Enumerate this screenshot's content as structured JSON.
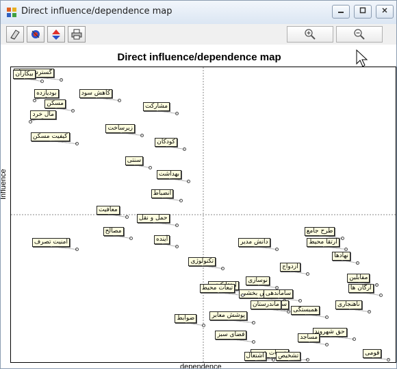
{
  "window": {
    "title": "Direct influence/dependence map",
    "controls": [
      {
        "name": "minimize-button",
        "icon": "minimize-icon"
      },
      {
        "name": "maximize-button",
        "icon": "maximize-icon"
      },
      {
        "name": "close-button",
        "icon": "close-icon"
      }
    ]
  },
  "toolbar": {
    "buttons": [
      {
        "name": "copy-button",
        "icon": "copy-icon"
      },
      {
        "name": "colors-button",
        "icon": "colors-icon"
      },
      {
        "name": "options-button",
        "icon": "options-icon"
      },
      {
        "name": "print-button",
        "icon": "print-icon"
      }
    ],
    "zoom_in": {
      "name": "zoom-in-button",
      "icon": "zoom-in-icon"
    },
    "zoom_out": {
      "name": "zoom-out-button",
      "icon": "zoom-out-icon"
    }
  },
  "chart_data": {
    "type": "scatter",
    "title": "Direct influence/dependence map",
    "xlabel": "dependence",
    "ylabel": "Influence",
    "quadrant_divider": "dashed",
    "points": [
      {
        "label": "گسترش شغل",
        "q": [
          0.12,
          0.02
        ]
      },
      {
        "label": "بیکاران",
        "q": [
          0.07,
          0.03
        ]
      },
      {
        "label": "بودیازده",
        "q": [
          0.05,
          0.1
        ]
      },
      {
        "label": "مسکن",
        "q": [
          0.15,
          0.14
        ]
      },
      {
        "label": "مال خرد",
        "q": [
          0.04,
          0.18
        ]
      },
      {
        "label": "کاهش سود",
        "q": [
          0.27,
          0.1
        ]
      },
      {
        "label": "مشارکت",
        "q": [
          0.42,
          0.15
        ]
      },
      {
        "label": "زیرساخت",
        "q": [
          0.33,
          0.23
        ]
      },
      {
        "label": "کیفیت مسکن",
        "q": [
          0.16,
          0.26
        ]
      },
      {
        "label": "کودکان",
        "q": [
          0.44,
          0.28
        ]
      },
      {
        "label": "سنتی",
        "q": [
          0.35,
          0.35
        ]
      },
      {
        "label": "بهداشت",
        "q": [
          0.45,
          0.4
        ]
      },
      {
        "label": "انضباط",
        "q": [
          0.43,
          0.47
        ]
      },
      {
        "label": "معافیت",
        "q": [
          0.29,
          0.53
        ]
      },
      {
        "label": "حمل و نقل",
        "q": [
          0.42,
          0.56
        ]
      },
      {
        "label": "امنیت تصرف",
        "q": [
          0.16,
          0.65
        ]
      },
      {
        "label": "مصالح",
        "q": [
          0.3,
          0.61
        ]
      },
      {
        "label": "آینده",
        "q": [
          0.42,
          0.64
        ]
      },
      {
        "label": "طرح جامع",
        "q": [
          0.85,
          0.61
        ]
      },
      {
        "label": "ارتقا محیط",
        "q": [
          0.86,
          0.65
        ]
      },
      {
        "label": "دانش مدیر",
        "q": [
          0.68,
          0.65
        ]
      },
      {
        "label": "تکنولوژی",
        "q": [
          0.54,
          0.72
        ]
      },
      {
        "label": "ازدواج",
        "q": [
          0.76,
          0.74
        ]
      },
      {
        "label": "نوسازی",
        "q": [
          0.68,
          0.79
        ]
      },
      {
        "label": "ارتقا کیفی",
        "q": [
          0.6,
          0.81
        ]
      },
      {
        "label": "نگرش بخشی",
        "q": [
          0.7,
          0.84
        ]
      },
      {
        "label": "ارگان ها",
        "q": [
          0.95,
          0.82
        ]
      },
      {
        "label": "سواد زنان",
        "q": [
          0.73,
          0.88
        ]
      },
      {
        "label": "ضوابط",
        "q": [
          0.49,
          0.93
        ]
      }
    ],
    "near_zero": [
      {
        "label": "تبعات محیط",
        "q": [
          0.59,
          0.82
        ]
      },
      {
        "label": "ساماندهی",
        "q": [
          0.74,
          0.84
        ]
      },
      {
        "label": "ماندرستان",
        "q": [
          0.71,
          0.88
        ]
      },
      {
        "label": "همبستگی",
        "q": [
          0.81,
          0.9
        ]
      },
      {
        "label": "نهادها",
        "q": [
          0.89,
          0.7
        ]
      },
      {
        "label": "مقابلین",
        "q": [
          0.94,
          0.78
        ]
      },
      {
        "label": "ناهنجاری",
        "q": [
          0.92,
          0.88
        ]
      },
      {
        "label": "پوشش معابر",
        "q": [
          0.62,
          0.92
        ]
      },
      {
        "label": "فضای سبز",
        "q": [
          0.62,
          0.99
        ]
      },
      {
        "label": "حق شهروند",
        "q": [
          0.88,
          0.98
        ]
      },
      {
        "label": "مساجد",
        "q": [
          0.81,
          1.0
        ]
      },
      {
        "label": "خدمات عموم",
        "q": [
          0.73,
          1.06
        ]
      },
      {
        "label": "تشخیص",
        "q": [
          0.76,
          1.1
        ]
      },
      {
        "label": "اشتغال",
        "q": [
          0.67,
          1.08
        ]
      },
      {
        "label": "قومی",
        "q": [
          0.97,
          1.06
        ]
      }
    ]
  }
}
